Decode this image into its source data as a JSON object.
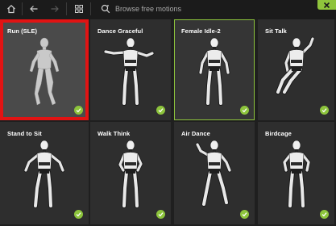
{
  "toolbar": {
    "search_placeholder": "Browse free motions",
    "icons": [
      "home-icon",
      "back-arrow-icon",
      "forward-arrow-icon",
      "grid-view-icon",
      "search-icon",
      "close-icon"
    ],
    "accent_color": "#8dc43c"
  },
  "motions": [
    {
      "label": "Run (SLE)",
      "figure": "plain",
      "state": "selected",
      "checked": true
    },
    {
      "label": "Dance Graceful",
      "figure": "armored",
      "state": "normal",
      "checked": true
    },
    {
      "label": "Female Idle-2",
      "figure": "armored",
      "state": "hovered",
      "checked": true
    },
    {
      "label": "Sit Talk",
      "figure": "armored",
      "state": "normal",
      "checked": true
    },
    {
      "label": "Stand to Sit",
      "figure": "armored",
      "state": "normal",
      "checked": true
    },
    {
      "label": "Walk Think",
      "figure": "armored",
      "state": "normal",
      "checked": true
    },
    {
      "label": "Air Dance",
      "figure": "armored",
      "state": "normal",
      "checked": true
    },
    {
      "label": "Birdcage",
      "figure": "armored",
      "state": "normal",
      "checked": true
    }
  ],
  "colors": {
    "selection_border": "#e11313",
    "hover_border": "#8dc43c",
    "check_badge": "#8dc43c"
  }
}
